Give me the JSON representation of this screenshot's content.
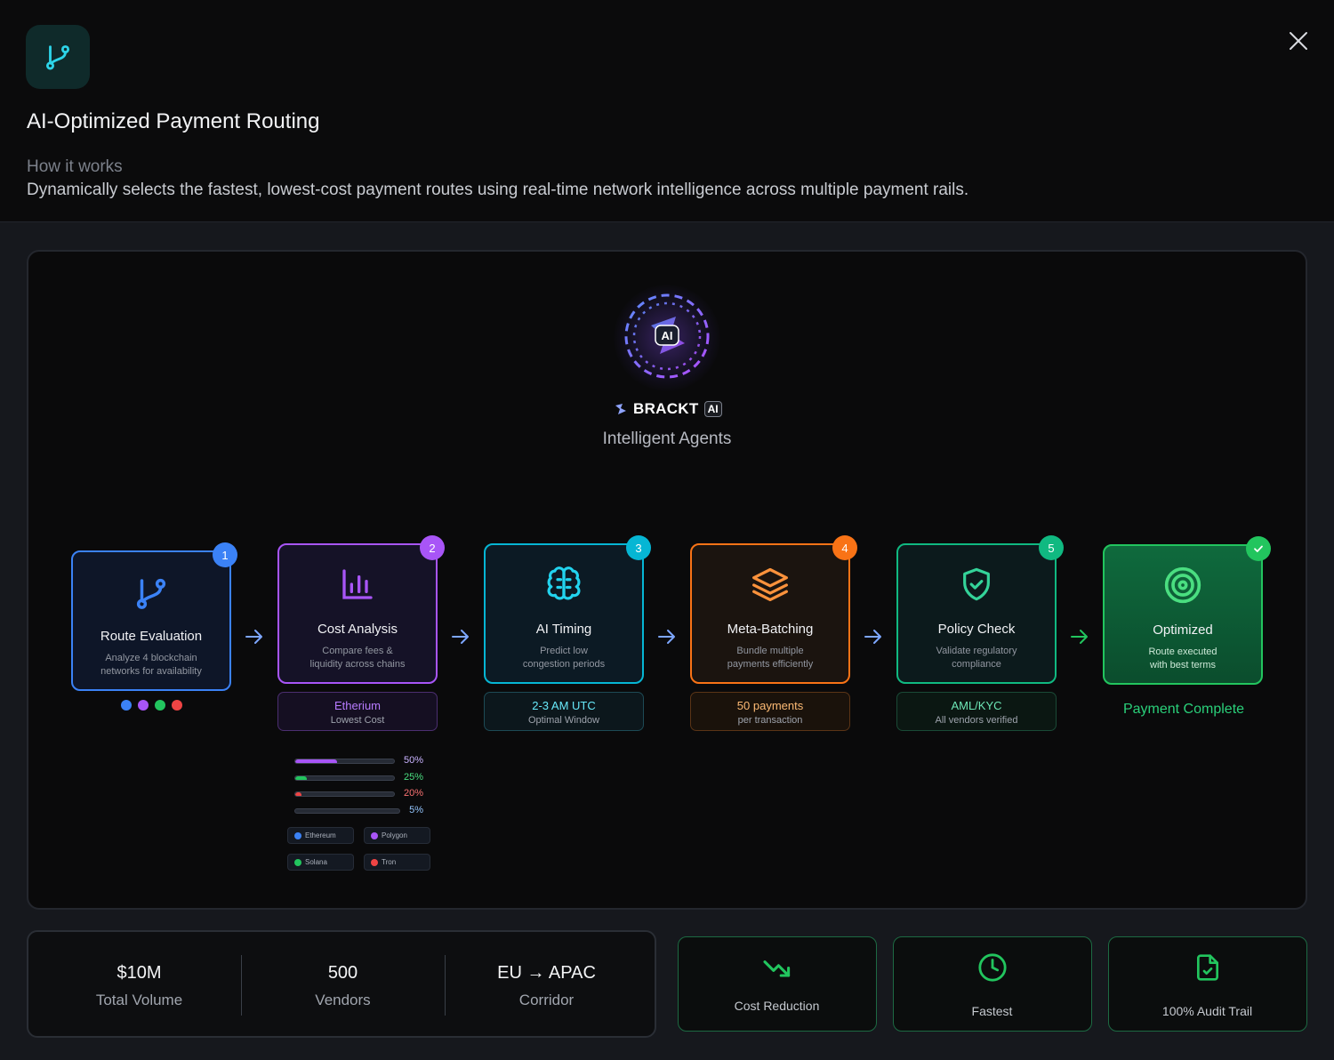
{
  "header": {
    "title": "AI-Optimized Payment Routing",
    "section_label": "How it works",
    "description": "Dynamically selects the fastest, lowest-cost payment routes using real-time network intelligence across multiple payment rails."
  },
  "hub": {
    "icon_text": "AI",
    "brand_name": "BRACKT",
    "brand_badge": "AI",
    "subtitle": "Intelligent Agents"
  },
  "steps": [
    {
      "number": "1",
      "title": "Route Evaluation",
      "desc_line1": "Analyze 4 blockchain",
      "desc_line2": "networks for availability",
      "color": "#3b82f6"
    },
    {
      "number": "2",
      "title": "Cost Analysis",
      "desc_line1": "Compare fees &",
      "desc_line2": "liquidity across chains",
      "color": "#a855f7"
    },
    {
      "number": "3",
      "title": "AI Timing",
      "desc_line1": "Predict low",
      "desc_line2": "congestion periods",
      "color": "#06b6d4"
    },
    {
      "number": "4",
      "title": "Meta-Batching",
      "desc_line1": "Bundle multiple",
      "desc_line2": "payments efficiently",
      "color": "#f97316"
    },
    {
      "number": "5",
      "title": "Policy Check",
      "desc_line1": "Validate regulatory",
      "desc_line2": "compliance",
      "color": "#10b981"
    },
    {
      "number": "✓",
      "title": "Optimized",
      "desc_line1": "Route executed",
      "desc_line2": "with best terms",
      "color": "#22c55e"
    }
  ],
  "info_boxes": [
    {
      "main": "Etherium",
      "sub": "Lowest Cost"
    },
    {
      "main": "2-3 AM UTC",
      "sub": "Optimal Window"
    },
    {
      "main": "50 payments",
      "sub": "per transaction"
    },
    {
      "main": "AML/KYC",
      "sub": "All vendors verified"
    }
  ],
  "completion_label": "Payment Complete",
  "network_dots": [
    "#3b82f6",
    "#a855f7",
    "#22c55e",
    "#ef4444"
  ],
  "cost_bars": [
    {
      "label": "50%",
      "value": 0.42,
      "color": "#a855f7"
    },
    {
      "label": "25%",
      "value": 0.12,
      "color": "#22c55e"
    },
    {
      "label": "20%",
      "value": 0.06,
      "color": "#ef4444"
    },
    {
      "label": "5%",
      "value": 0.0,
      "color": "#3b82f6"
    }
  ],
  "chains": [
    {
      "name": "Ethereum",
      "color": "#3b82f6"
    },
    {
      "name": "Polygon",
      "color": "#a855f7"
    },
    {
      "name": "Solana",
      "color": "#22c55e"
    },
    {
      "name": "Tron",
      "color": "#ef4444"
    }
  ],
  "stats": [
    {
      "value": "$10M",
      "label": "Total Volume"
    },
    {
      "value": "500",
      "label": "Vendors"
    },
    {
      "value": "EU → APAC",
      "label": "Corridor"
    }
  ],
  "features": [
    {
      "label": "Cost Reduction",
      "icon": "trending-down-icon"
    },
    {
      "label": "Fastest",
      "icon": "clock-icon"
    },
    {
      "label": "100% Audit Trail",
      "icon": "file-check-icon"
    }
  ]
}
